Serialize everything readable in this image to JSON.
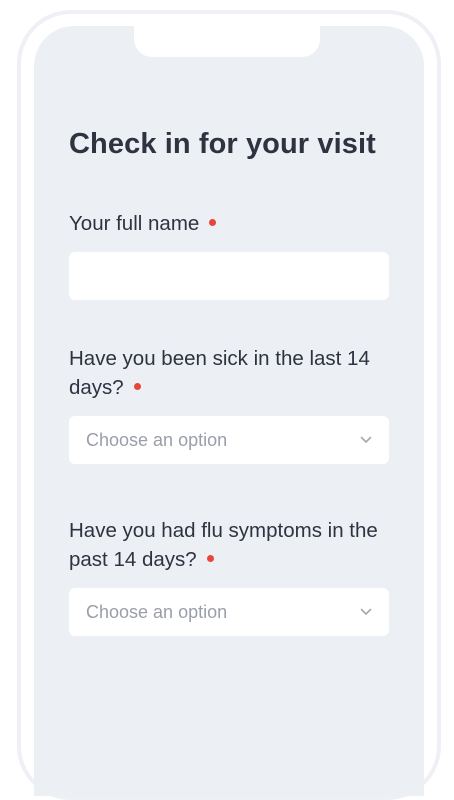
{
  "form": {
    "title": "Check in for your visit",
    "fields": [
      {
        "label": "Your full name",
        "value": "",
        "placeholder": ""
      },
      {
        "label": "Have you been sick in the last 14 days?",
        "selected": "Choose an option"
      },
      {
        "label": "Have you had flu symptoms in the past 14 days?",
        "selected": "Choose an option"
      }
    ]
  },
  "colors": {
    "screen_bg": "#eceff4",
    "text": "#2f3340",
    "required_dot": "#e7443a",
    "placeholder": "#9a9ea8"
  },
  "icons": {
    "required": "required-dot-icon",
    "dropdown": "chevron-down-icon"
  }
}
